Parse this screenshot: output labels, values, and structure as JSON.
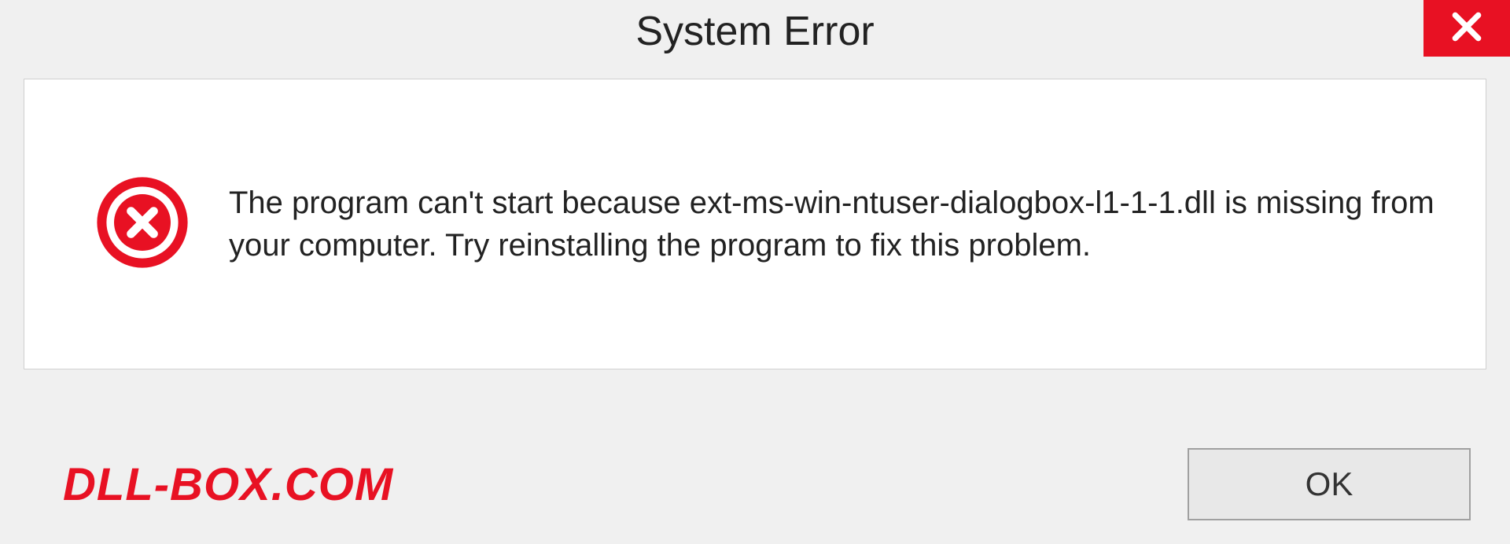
{
  "window": {
    "title": "System Error"
  },
  "dialog": {
    "message": "The program can't start because ext-ms-win-ntuser-dialogbox-l1-1-1.dll is missing from your computer. Try reinstalling the program to fix this problem."
  },
  "footer": {
    "brand": "DLL-BOX.COM",
    "ok_label": "OK"
  },
  "colors": {
    "accent_red": "#e81123",
    "background": "#f0f0f0",
    "content_bg": "#ffffff"
  }
}
